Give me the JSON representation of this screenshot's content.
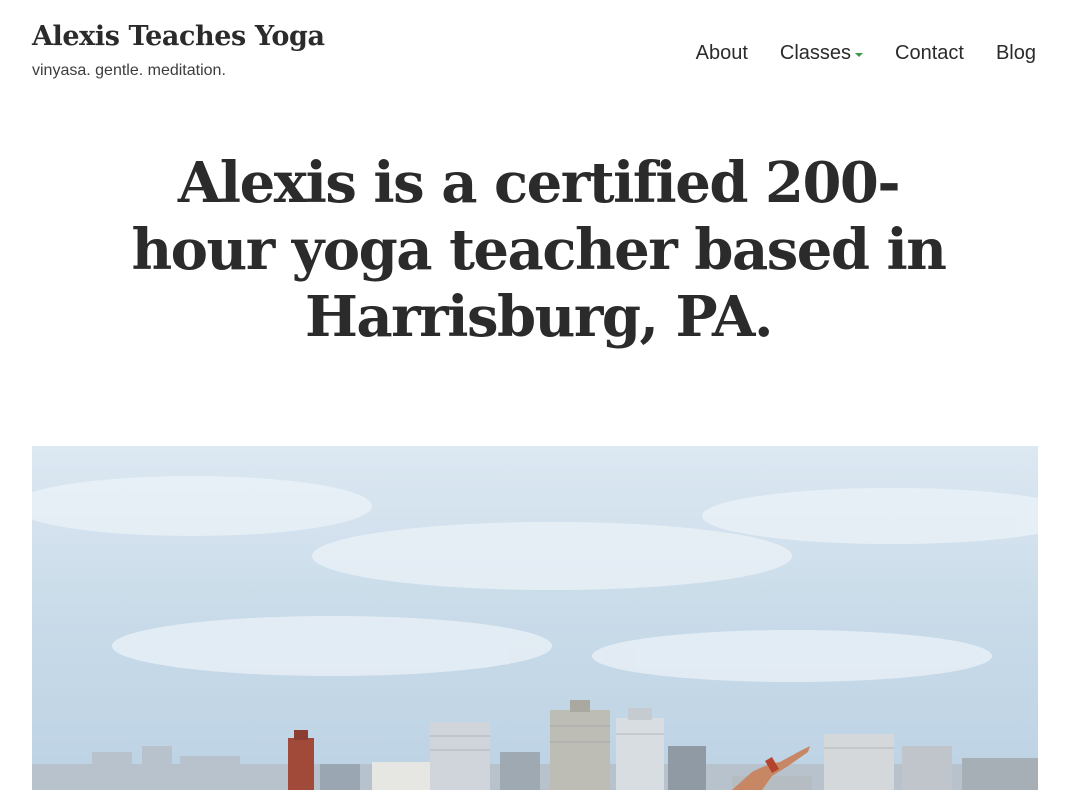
{
  "site": {
    "title": "Alexis Teaches Yoga",
    "tagline": "vinyasa. gentle. meditation."
  },
  "nav": {
    "items": [
      {
        "label": "About",
        "has_dropdown": false
      },
      {
        "label": "Classes",
        "has_dropdown": true
      },
      {
        "label": "Contact",
        "has_dropdown": false
      },
      {
        "label": "Blog",
        "has_dropdown": false
      }
    ]
  },
  "hero": {
    "heading": "Alexis is a certified 200-hour yoga teacher based in Harrisburg, PA."
  },
  "colors": {
    "text": "#2b2b2b",
    "dropdown_caret": "#3a9a4a",
    "sky": "#cfe0ee"
  },
  "image": {
    "subject": "photo-yoga-pose-harrisburg-skyline"
  }
}
